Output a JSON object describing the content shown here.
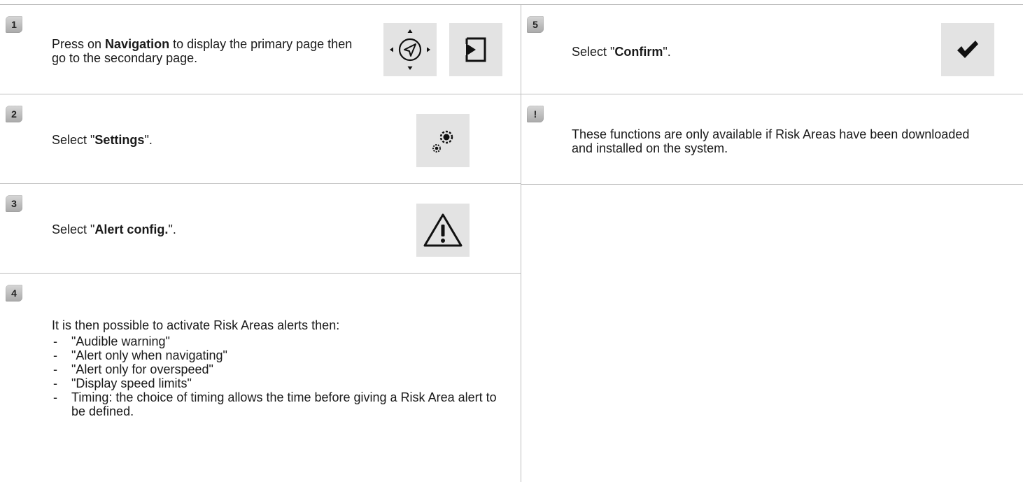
{
  "steps": [
    {
      "number": "1",
      "parts": {
        "prefix": "Press on ",
        "bold": "Navigation",
        "suffix": " to display the primary page then go to the secondary page."
      },
      "icons": [
        "navigation-compass-icon",
        "secondary-page-icon"
      ]
    },
    {
      "number": "2",
      "parts": {
        "prefix": "Select \"",
        "bold": "Settings",
        "suffix": "\"."
      },
      "icons": [
        "settings-gears-icon"
      ]
    },
    {
      "number": "3",
      "parts": {
        "prefix": "Select \"",
        "bold": "Alert config.",
        "suffix": "\"."
      },
      "icons": [
        "warning-triangle-icon"
      ]
    },
    {
      "number": "4",
      "intro": "It is then possible to activate Risk Areas alerts then:",
      "options": [
        "\"Audible warning\"",
        "\"Alert only when navigating\"",
        "\"Alert only for overspeed\"",
        "\"Display speed limits\"",
        "Timing: the choice of timing allows the time before giving a Risk Area alert to be defined."
      ]
    },
    {
      "number": "5",
      "parts": {
        "prefix": "Select \"",
        "bold": "Confirm",
        "suffix": "\"."
      },
      "icons": [
        "checkmark-icon"
      ]
    }
  ],
  "note": {
    "symbol": "!",
    "text": "These functions are only available if Risk Areas have been downloaded and installed on the system."
  },
  "colors": {
    "divider": "#bdbdbd",
    "icon_bg": "#e3e3e3",
    "badge": "#b4b4b4"
  }
}
